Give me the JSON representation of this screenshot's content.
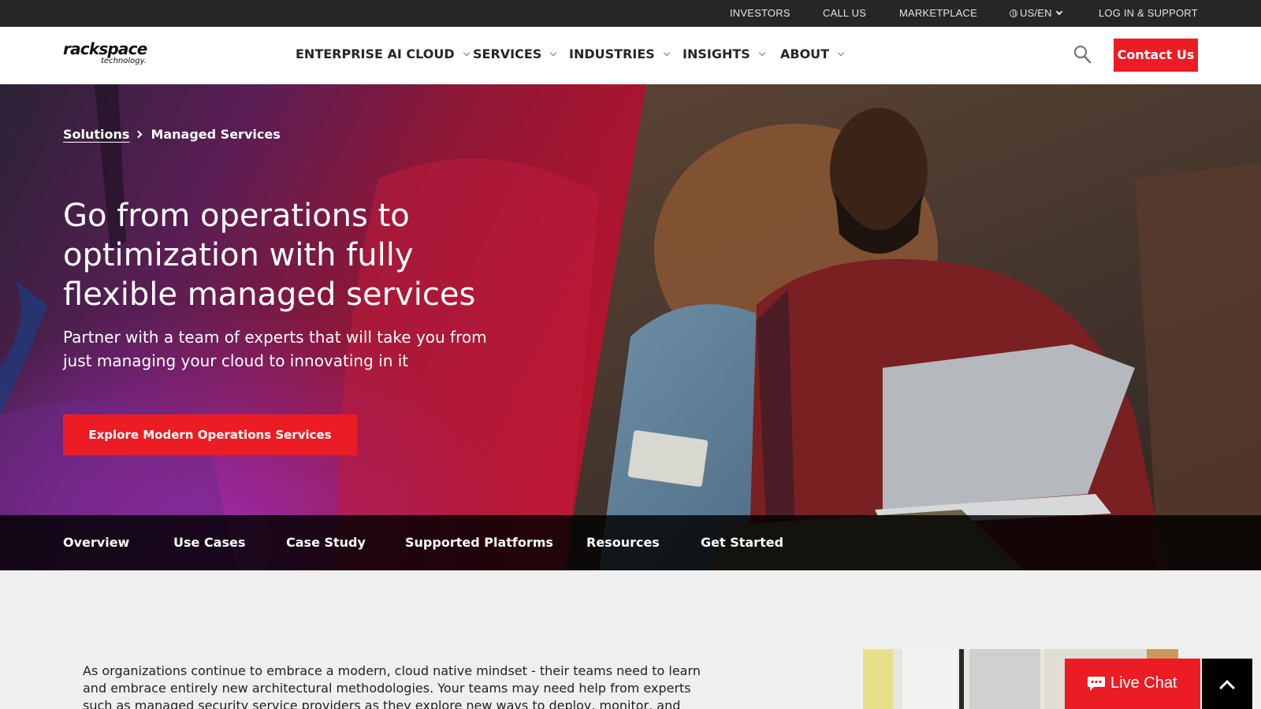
{
  "utility_nav": {
    "investors": "INVESTORS",
    "call_us": "CALL US",
    "marketplace": "MARKETPLACE",
    "locale": "US/EN",
    "login": "LOG IN & SUPPORT"
  },
  "header": {
    "logo_main": "rackspace",
    "logo_sub": "technology.",
    "nav": {
      "ai_cloud": "ENTERPRISE AI CLOUD",
      "services": "SERVICES",
      "industries": "INDUSTRIES",
      "insights": "INSIGHTS",
      "about": "ABOUT"
    },
    "contact_label": "Contact Us"
  },
  "hero": {
    "breadcrumb_parent": "Solutions",
    "breadcrumb_current": "Managed Services",
    "title": "Go from operations to optimization with fully flexible managed services",
    "subtitle": "Partner with a team of experts that will take you from just managing your cloud to innovating in it",
    "cta_label": "Explore Modern Operations Services"
  },
  "sub_nav": {
    "overview": "Overview",
    "use_cases": "Use Cases",
    "case_study": "Case Study",
    "supported_platforms": "Supported Platforms",
    "resources": "Resources",
    "get_started": "Get Started"
  },
  "content": {
    "intro": "As organizations continue to embrace a modern, cloud native mindset - their teams need to learn and embrace entirely new architectural methodologies. Your teams may need help from experts such as managed security service providers as they explore new ways to deploy, monitor, and operate"
  },
  "widgets": {
    "live_chat": "Live Chat"
  },
  "colors": {
    "brand_red": "#eb1c24",
    "utility_bar": "#262626",
    "sub_nav_bg": "#000000"
  }
}
